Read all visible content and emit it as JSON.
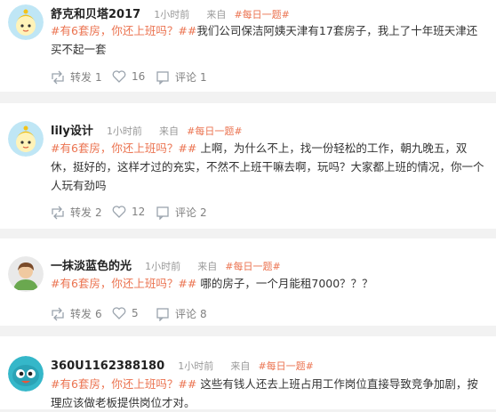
{
  "source_label": "来自",
  "source_link": "#每日一题#",
  "actions": {
    "repost": "转发",
    "comment": "评论"
  },
  "posts": [
    {
      "username": "舒克和贝塔2017",
      "time": "1小时前",
      "tag": "#有6套房，你还上班吗？#",
      "text": "我们公司保洁阿姨天津有17套房子，我上了十年班天津还买不起一套",
      "reposts": "1",
      "likes": "16",
      "comments": "1",
      "avatar_icon": "yellow-doll-avatar-icon"
    },
    {
      "username": "lily设计",
      "time": "1小时前",
      "tag": "#有6套房，你还上班吗？#",
      "text": "上啊，为什么不上，找一份轻松的工作，朝九晚五，双休，挺好的，这样才过的充实，不然不上班干嘛去啊，玩吗？大家都上班的情况，你一个人玩有劲吗",
      "reposts": "2",
      "likes": "12",
      "comments": "2",
      "avatar_icon": "yellow-doll-avatar-icon"
    },
    {
      "username": "一抹淡蓝色的光",
      "time": "1小时前",
      "tag": "#有6套房，你还上班吗？#",
      "text": "哪的房子，一个月能租7000？？？",
      "reposts": "6",
      "likes": "5",
      "comments": "8",
      "avatar_icon": "default-person-avatar-icon"
    },
    {
      "username": "360U1162388180",
      "time": "1小时前",
      "tag": "#有6套房，你还上班吗？#",
      "text": "这些有钱人还去上班占用工作岗位直接导致竞争加剧，按理应该做老板提供岗位才对。",
      "reposts": "",
      "likes": "",
      "comments": "",
      "avatar_icon": "cyan-bird-avatar-icon"
    }
  ]
}
